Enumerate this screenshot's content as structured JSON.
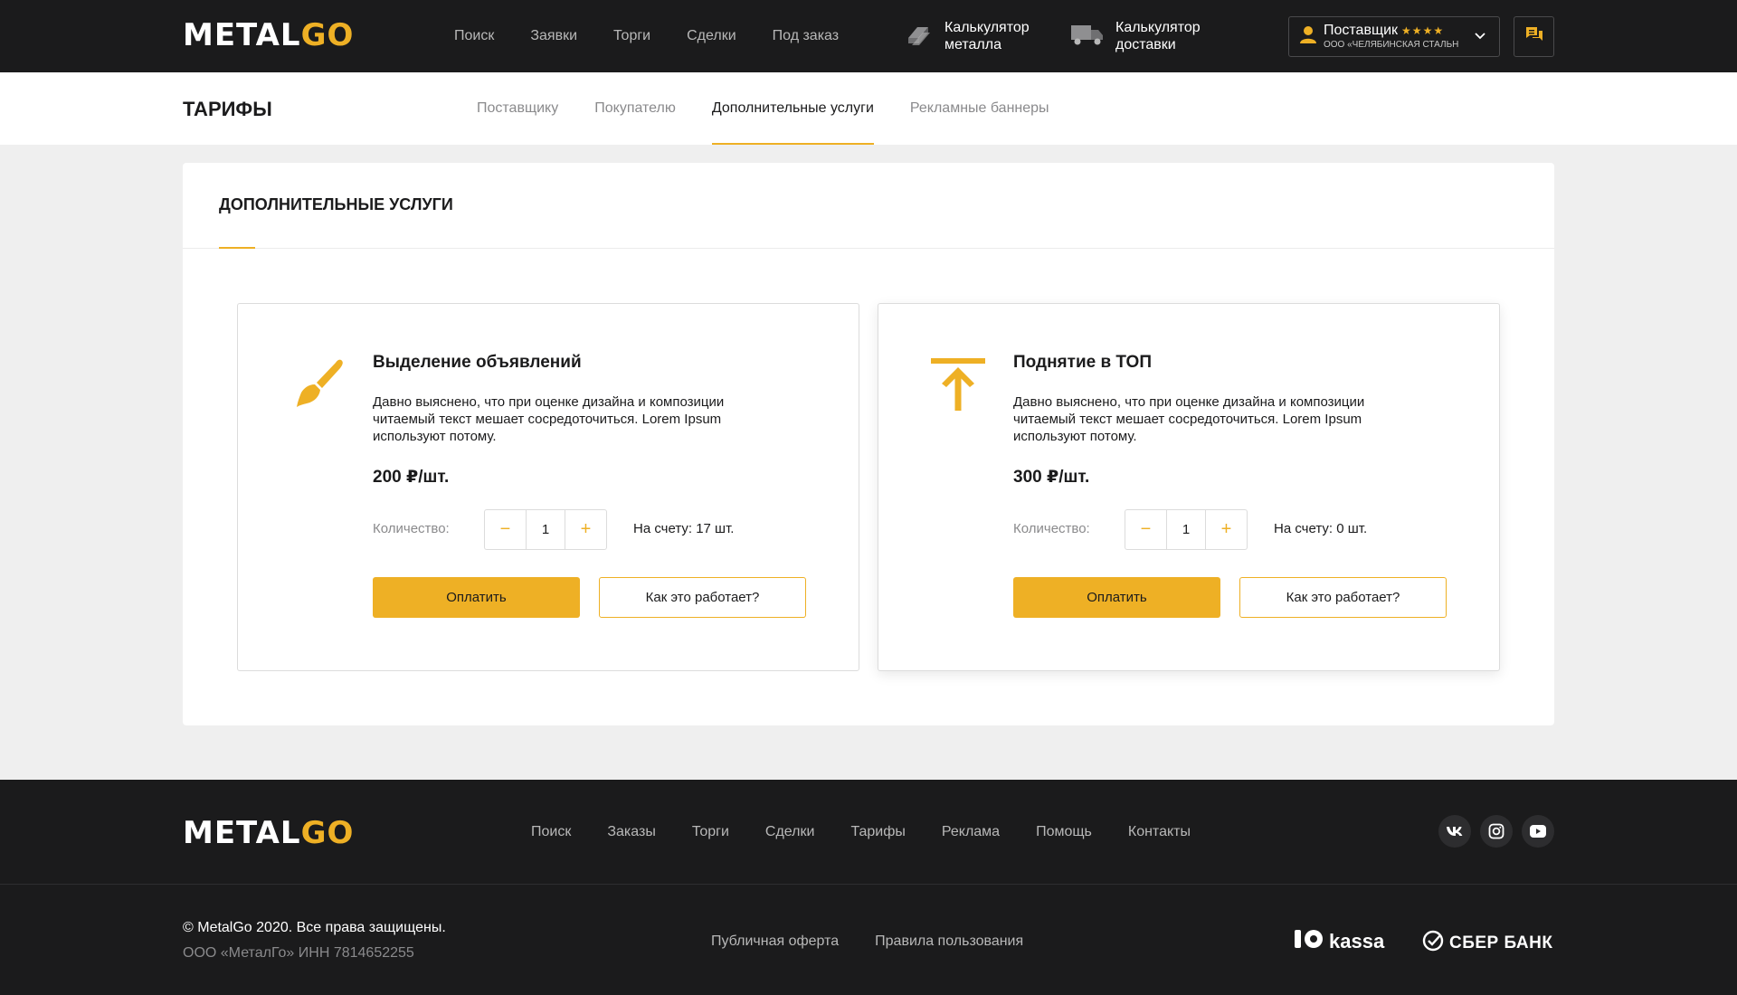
{
  "brand": {
    "part1": "METAL",
    "part2": "GO"
  },
  "header": {
    "nav": [
      "Поиск",
      "Заявки",
      "Торги",
      "Сделки",
      "Под заказ"
    ],
    "calc_metal": "Калькулятор металла",
    "calc_delivery": "Калькулятор доставки",
    "user": {
      "role": "Поставщик",
      "stars": "★★★★",
      "company": "ООО «ЧЕЛЯБИНСКАЯ СТАЛЬН..."
    },
    "icons": [
      "metal-calc-icon",
      "truck-icon",
      "user-icon",
      "chevron-down-icon",
      "chat-icon"
    ]
  },
  "subheader": {
    "title": "ТАРИФЫ",
    "tabs": [
      "Поставщику",
      "Покупателю",
      "Дополнительные услуги",
      "Рекламные баннеры"
    ],
    "active_tab": "Дополнительные услуги"
  },
  "panel": {
    "title": "ДОПОЛНИТЕЛЬНЫЕ УСЛУГИ",
    "cards": [
      {
        "icon": "brush-icon",
        "title": "Выделение объявлений",
        "description": "Давно выяснено, что при оценке дизайна и композиции читаемый текст мешает сосредоточиться. Lorem Ipsum используют потому.",
        "price": "200 ₽/шт.",
        "qty_label": "Количество:",
        "qty": "1",
        "minus": "−",
        "plus": "+",
        "balance": "На счету: 17 шт.",
        "pay": "Оплатить",
        "how": "Как это работает?"
      },
      {
        "icon": "arrow-up-top-icon",
        "title": "Поднятие в ТОП",
        "description": "Давно выяснено, что при оценке дизайна и композиции читаемый текст мешает сосредоточиться. Lorem Ipsum используют потому.",
        "price": "300 ₽/шт.",
        "qty_label": "Количество:",
        "qty": "1",
        "minus": "−",
        "plus": "+",
        "balance": "На счету: 0 шт.",
        "pay": "Оплатить",
        "how": "Как это работает?"
      }
    ]
  },
  "footer": {
    "nav": [
      "Поиск",
      "Заказы",
      "Торги",
      "Сделки",
      "Тарифы",
      "Реклама",
      "Помощь",
      "Контакты"
    ],
    "socials": [
      "vk-icon",
      "instagram-icon",
      "youtube-icon"
    ],
    "copyright": "© MetalGo 2020. Все права защищены.",
    "legal": "ООО «МеталГо» ИНН 7814652255",
    "links": [
      "Публичная оферта",
      "Правила пользования"
    ],
    "kassa": "kassa",
    "sber": "СБЕР БАНК"
  },
  "colors": {
    "accent": "#eeb025",
    "dark": "#1b1b1c",
    "background": "#efefef"
  }
}
